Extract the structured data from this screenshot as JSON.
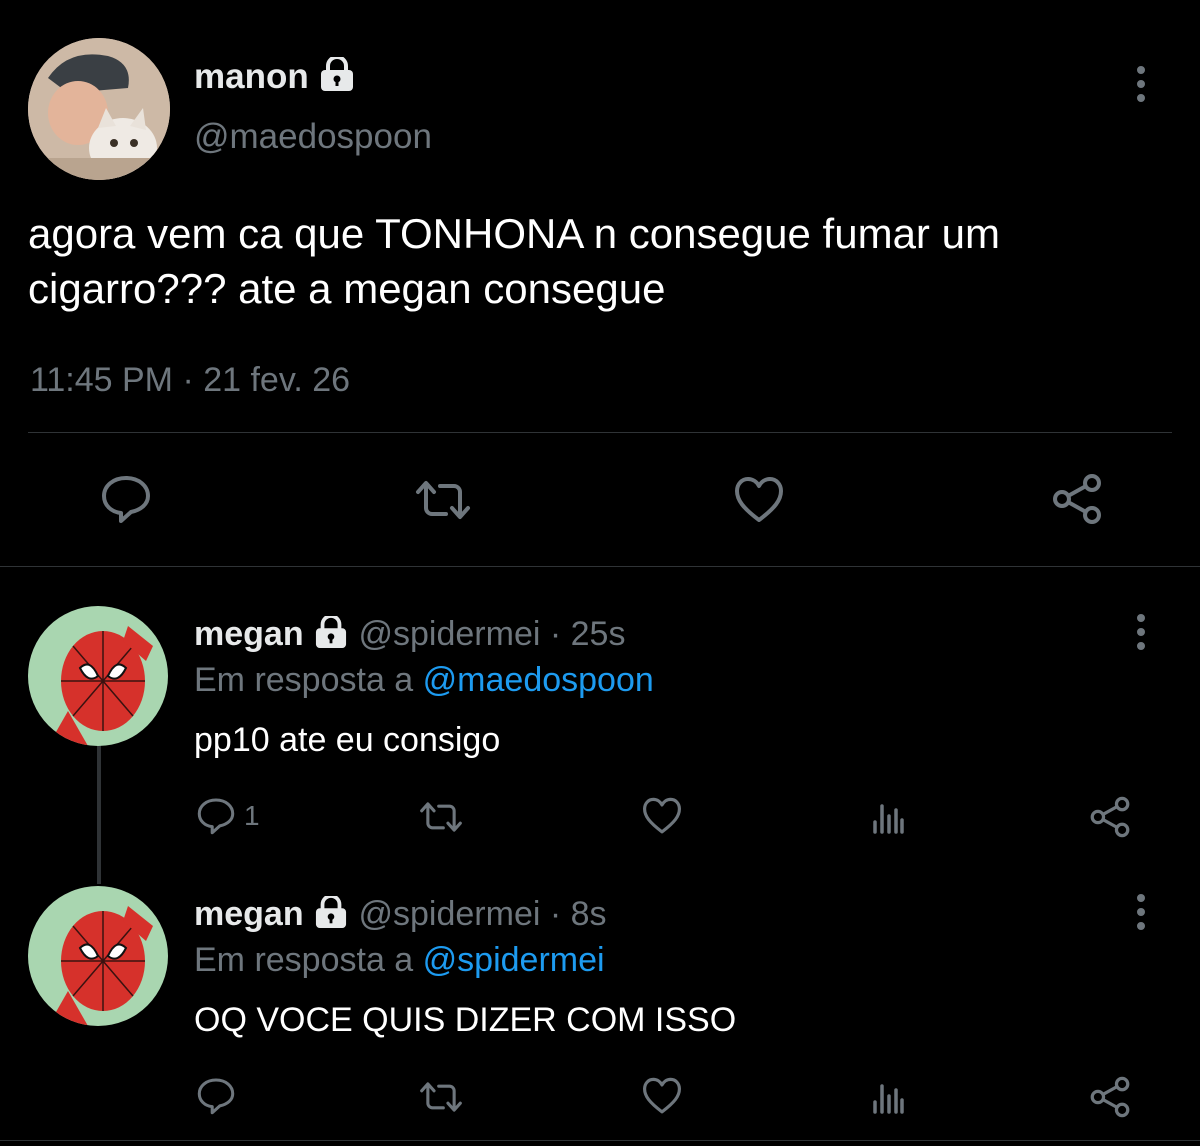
{
  "main_tweet": {
    "display_name": "manon",
    "handle": "@maedospoon",
    "text": "agora vem ca que TONHONA n consegue fumar um cigarro??? ate a megan consegue",
    "timestamp": "11:45 PM · 21 fev. 26",
    "avatar_icon": "avatar-cat-photo"
  },
  "replies": [
    {
      "display_name": "megan",
      "handle": "@spidermei",
      "separator": "·",
      "time": "25s",
      "reply_prefix": "Em resposta a",
      "reply_to": "@maedospoon",
      "text": "pp10 ate eu consigo",
      "reply_count": "1"
    },
    {
      "display_name": "megan",
      "handle": "@spidermei",
      "separator": "·",
      "time": "8s",
      "reply_prefix": "Em resposta a",
      "reply_to": "@spidermei",
      "text": "OQ VOCE QUIS DIZER COM ISSO",
      "reply_count": ""
    }
  ],
  "colors": {
    "background": "#000000",
    "text": "#e7e9ea",
    "muted": "#6e767d",
    "link": "#1d9bf0",
    "divider": "#2f3336"
  }
}
